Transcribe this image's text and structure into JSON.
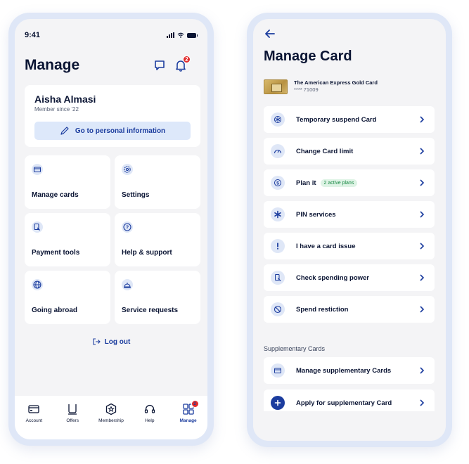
{
  "manage": {
    "status_time": "9:41",
    "title": "Manage",
    "notification_count": "2",
    "profile": {
      "name": "Aisha Almasi",
      "member_since": "Member since '22",
      "button_label": "Go to personal information"
    },
    "tiles": [
      {
        "label": "Manage cards",
        "icon": "card-icon"
      },
      {
        "label": "Settings",
        "icon": "settings-gear-icon"
      },
      {
        "label": "Payment tools",
        "icon": "payment-tools-icon"
      },
      {
        "label": "Help & support",
        "icon": "help-question-icon"
      },
      {
        "label": "Going abroad",
        "icon": "globe-icon"
      },
      {
        "label": "Service requests",
        "icon": "service-bell-icon"
      }
    ],
    "logout_label": "Log out",
    "tabs": [
      {
        "label": "Account",
        "icon": "account-card-icon"
      },
      {
        "label": "Offers",
        "icon": "offers-bag-icon"
      },
      {
        "label": "Membership",
        "icon": "membership-star-icon"
      },
      {
        "label": "Help",
        "icon": "help-headset-icon"
      },
      {
        "label": "Manage",
        "icon": "manage-grid-icon",
        "badge": "2"
      }
    ]
  },
  "manage_card": {
    "title": "Manage Card",
    "card_name": "The American Express Gold Card",
    "card_number": "**** 71009",
    "actions": [
      {
        "label": "Temporary suspend Card",
        "icon": "snowflake-icon"
      },
      {
        "label": "Change Card limit",
        "icon": "gauge-icon"
      },
      {
        "label": "Plan it",
        "pill": "2 active plans",
        "icon": "plan-dollar-icon"
      },
      {
        "label": "PIN services",
        "icon": "asterisk-icon"
      },
      {
        "label": "I have a card issue",
        "icon": "exclamation-icon"
      },
      {
        "label": "Check spending power",
        "icon": "spending-power-icon"
      },
      {
        "label": "Spend restiction",
        "icon": "restriction-icon"
      }
    ],
    "supplementary_section": "Supplementary Cards",
    "supplementary_actions": [
      {
        "label": "Manage supplementary Cards",
        "icon": "card-icon"
      },
      {
        "label": "Apply for supplementary Card",
        "icon": "plus-circle-icon"
      }
    ]
  },
  "colors": {
    "accent": "#1b3c9e",
    "badge": "#e22b2b",
    "screen_bg": "#f4f4f6",
    "frame": "#dfe7f7"
  }
}
